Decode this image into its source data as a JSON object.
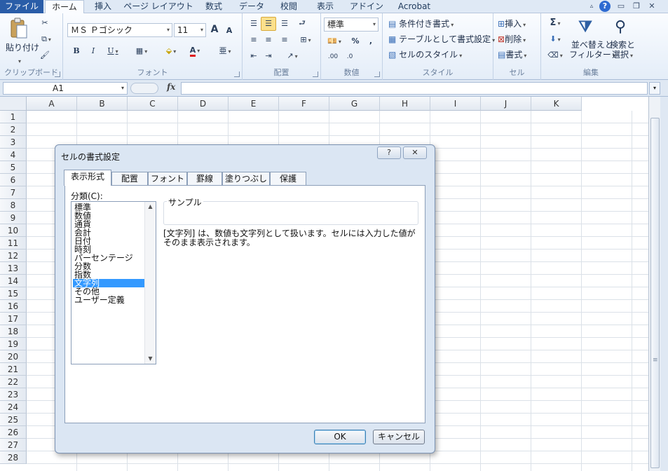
{
  "ribbon_tabs": [
    {
      "label": "ファイル"
    },
    {
      "label": "ホーム"
    },
    {
      "label": "挿入"
    },
    {
      "label": "ページ レイアウト"
    },
    {
      "label": "数式"
    },
    {
      "label": "データ"
    },
    {
      "label": "校閲"
    },
    {
      "label": "表示"
    },
    {
      "label": "アドイン"
    },
    {
      "label": "Acrobat"
    }
  ],
  "window_controls": {
    "help": "?",
    "minimize": "▭",
    "restore": "❐",
    "close": "✕"
  },
  "clipboard": {
    "paste": "貼り付け",
    "group": "クリップボード"
  },
  "font": {
    "name": "ＭＳ Ｐゴシック",
    "size": "11",
    "bold": "B",
    "italic": "I",
    "underline": "U",
    "grow": "A",
    "shrink": "A",
    "color_a": "A",
    "group": "フォント"
  },
  "alignment": {
    "group": "配置"
  },
  "number": {
    "format": "標準",
    "percent": "%",
    "comma": ",",
    "inc_decimal": ".00",
    "dec_decimal": ".0",
    "group": "数値"
  },
  "styles": {
    "conditional": "条件付き書式",
    "table": "テーブルとして書式設定",
    "cell_styles": "セルのスタイル",
    "group": "スタイル"
  },
  "cells": {
    "insert": "挿入",
    "delete": "削除",
    "format": "書式",
    "group": "セル"
  },
  "editing": {
    "autosum": "Σ",
    "sort_filter_1": "並べ替えと",
    "sort_filter_2": "フィルター",
    "find_select_1": "検索と",
    "find_select_2": "選択",
    "group": "編集"
  },
  "formula_bar": {
    "name_box": "A1",
    "fx": "fx",
    "value": ""
  },
  "columns": [
    "A",
    "B",
    "C",
    "D",
    "E",
    "F",
    "G",
    "H",
    "I",
    "J",
    "K"
  ],
  "rows": [
    "1",
    "2",
    "3",
    "4",
    "5",
    "6",
    "7",
    "8",
    "9",
    "10",
    "11",
    "12",
    "13",
    "14",
    "15",
    "16",
    "17",
    "18",
    "19",
    "20",
    "21",
    "22",
    "23",
    "24",
    "25",
    "26",
    "27",
    "28"
  ],
  "dialog": {
    "title": "セルの書式設定",
    "help": "?",
    "close": "✕",
    "tabs": [
      {
        "label": "表示形式"
      },
      {
        "label": "配置"
      },
      {
        "label": "フォント"
      },
      {
        "label": "罫線"
      },
      {
        "label": "塗りつぶし"
      },
      {
        "label": "保護"
      }
    ],
    "category_label": "分類(C):",
    "categories": [
      "標準",
      "数値",
      "通貨",
      "会計",
      "日付",
      "時刻",
      "パーセンテージ",
      "分数",
      "指数",
      "文字列",
      "その他",
      "ユーザー定義"
    ],
    "selected_category": "文字列",
    "sample_label": "サンプル",
    "description": "[文字列] は、数値も文字列として扱います。セルには入力した値がそのまま表示されます。",
    "ok": "OK",
    "cancel": "キャンセル"
  },
  "colors": {
    "accent": "#2a5da8",
    "selection": "#3399ff",
    "ribbon_bg": "#e4edf8",
    "dialog_bg": "#dbe6f3"
  }
}
